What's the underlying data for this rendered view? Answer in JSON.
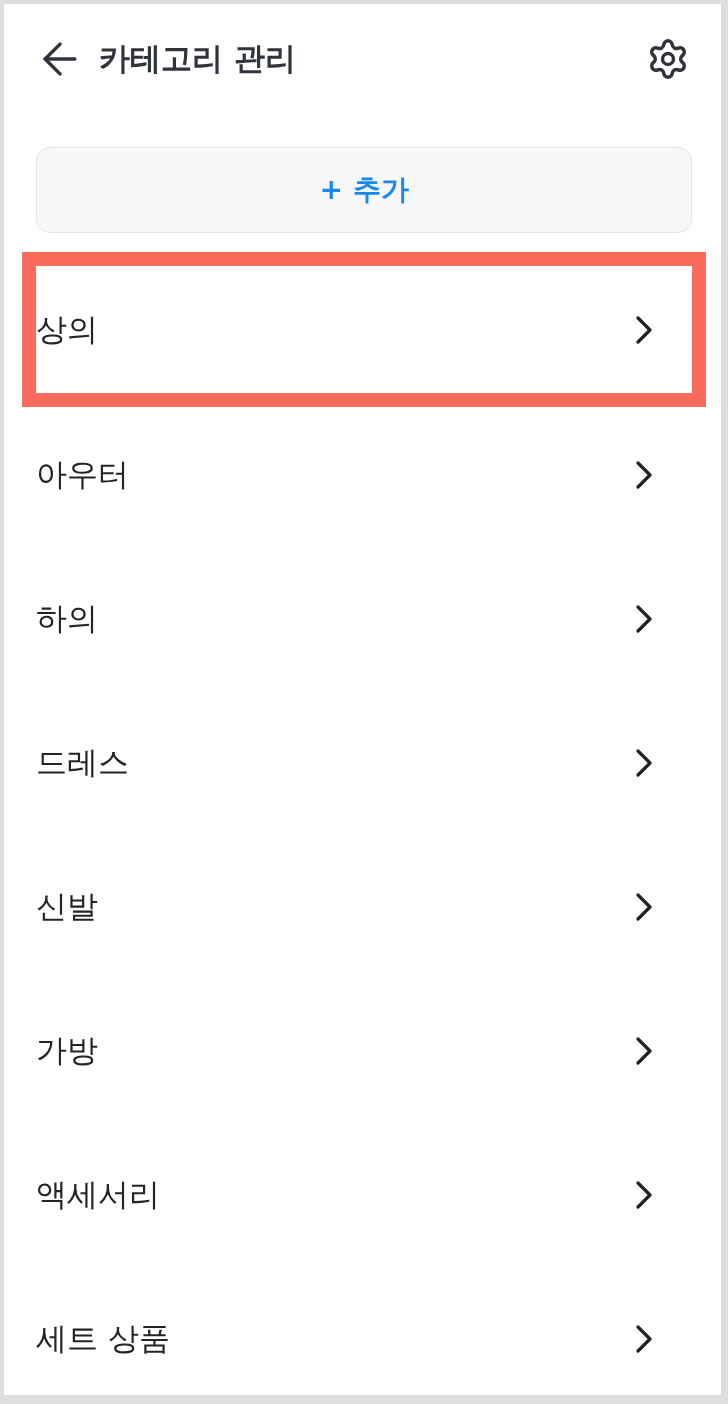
{
  "header": {
    "title": "카테고리 관리"
  },
  "add_button": {
    "label": "+ 추가"
  },
  "categories": [
    {
      "label": "상의",
      "highlighted": true
    },
    {
      "label": "아우터",
      "highlighted": false
    },
    {
      "label": "하의",
      "highlighted": false
    },
    {
      "label": "드레스",
      "highlighted": false
    },
    {
      "label": "신발",
      "highlighted": false
    },
    {
      "label": "가방",
      "highlighted": false
    },
    {
      "label": "액세서리",
      "highlighted": false
    },
    {
      "label": "세트 상품",
      "highlighted": false
    }
  ]
}
